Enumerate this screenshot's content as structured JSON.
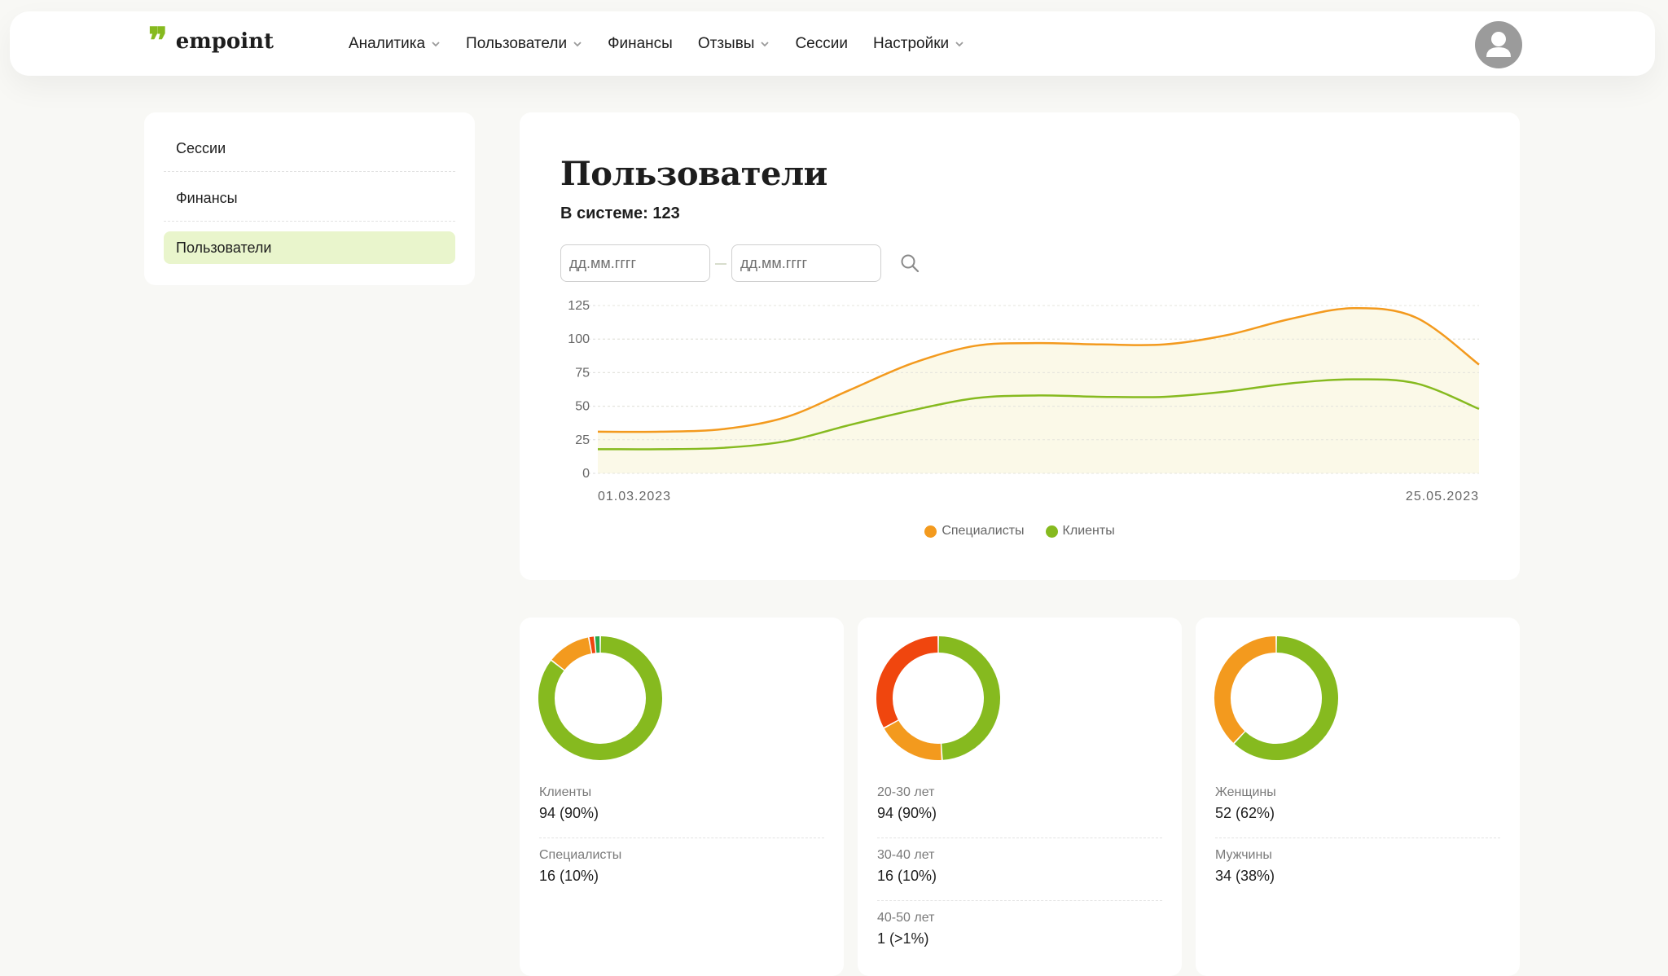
{
  "header": {
    "logo_mark": "❞",
    "logo_text": "empoint",
    "nav": [
      {
        "label": "Аналитика",
        "dropdown": true
      },
      {
        "label": "Пользователи",
        "dropdown": true
      },
      {
        "label": "Финансы",
        "dropdown": false
      },
      {
        "label": "Отзывы",
        "dropdown": true
      },
      {
        "label": "Сессии",
        "dropdown": false
      },
      {
        "label": "Настройки",
        "dropdown": true
      }
    ],
    "avatar_icon": "user-avatar-icon"
  },
  "sidebar": {
    "items": [
      {
        "label": "Сессии",
        "active": false
      },
      {
        "label": "Финансы",
        "active": false
      },
      {
        "label": "Пользователи",
        "active": true
      }
    ]
  },
  "main": {
    "title": "Пользователи",
    "system_count": "В системе: 123",
    "date_from_placeholder": "дд.мм.гггг",
    "date_to_placeholder": "дд.мм.гггг",
    "search_icon": "search-icon"
  },
  "chart_data": {
    "type": "area",
    "title": "",
    "xlabel": "",
    "ylabel": "",
    "x_tick_labels": [
      "01.03.2023",
      "25.05.2023"
    ],
    "y_ticks": [
      0,
      25,
      50,
      75,
      100,
      125
    ],
    "ylim": [
      0,
      125
    ],
    "grid": true,
    "legend_position": "bottom-center",
    "series": [
      {
        "name": "Специалисты",
        "color": "#f39a1e",
        "values": [
          31,
          31,
          33,
          42,
          62,
          82,
          95,
          97,
          96,
          96,
          103,
          115,
          123,
          116,
          81
        ]
      },
      {
        "name": "Клиенты",
        "color": "#86ba1f",
        "values": [
          18,
          18,
          19,
          24,
          36,
          47,
          56,
          58,
          57,
          57,
          61,
          67,
          70,
          67,
          48
        ]
      }
    ]
  },
  "stats": [
    {
      "items": [
        {
          "label": "Клиенты",
          "value": "94 (90%)"
        },
        {
          "label": "Специалисты",
          "value": "16 (10%)"
        }
      ],
      "donut": [
        {
          "share": 0.855,
          "color": "#86ba1f"
        },
        {
          "share": 0.115,
          "color": "#f39a1e"
        },
        {
          "share": 0.015,
          "color": "#f0460e"
        },
        {
          "share": 0.015,
          "color": "#2aa84a"
        }
      ]
    },
    {
      "items": [
        {
          "label": "20-30 лет",
          "value": "94 (90%)"
        },
        {
          "label": "30-40 лет",
          "value": "16 (10%)"
        },
        {
          "label": "40-50 лет",
          "value": "1 (>1%)"
        }
      ],
      "donut": [
        {
          "share": 0.49,
          "color": "#86ba1f"
        },
        {
          "share": 0.18,
          "color": "#f39a1e"
        },
        {
          "share": 0.33,
          "color": "#f0460e"
        }
      ]
    },
    {
      "items": [
        {
          "label": "Женщины",
          "value": "52 (62%)"
        },
        {
          "label": "Мужчины",
          "value": "34 (38%)"
        }
      ],
      "donut": [
        {
          "share": 0.62,
          "color": "#86ba1f"
        },
        {
          "share": 0.38,
          "color": "#f39a1e"
        }
      ]
    }
  ]
}
